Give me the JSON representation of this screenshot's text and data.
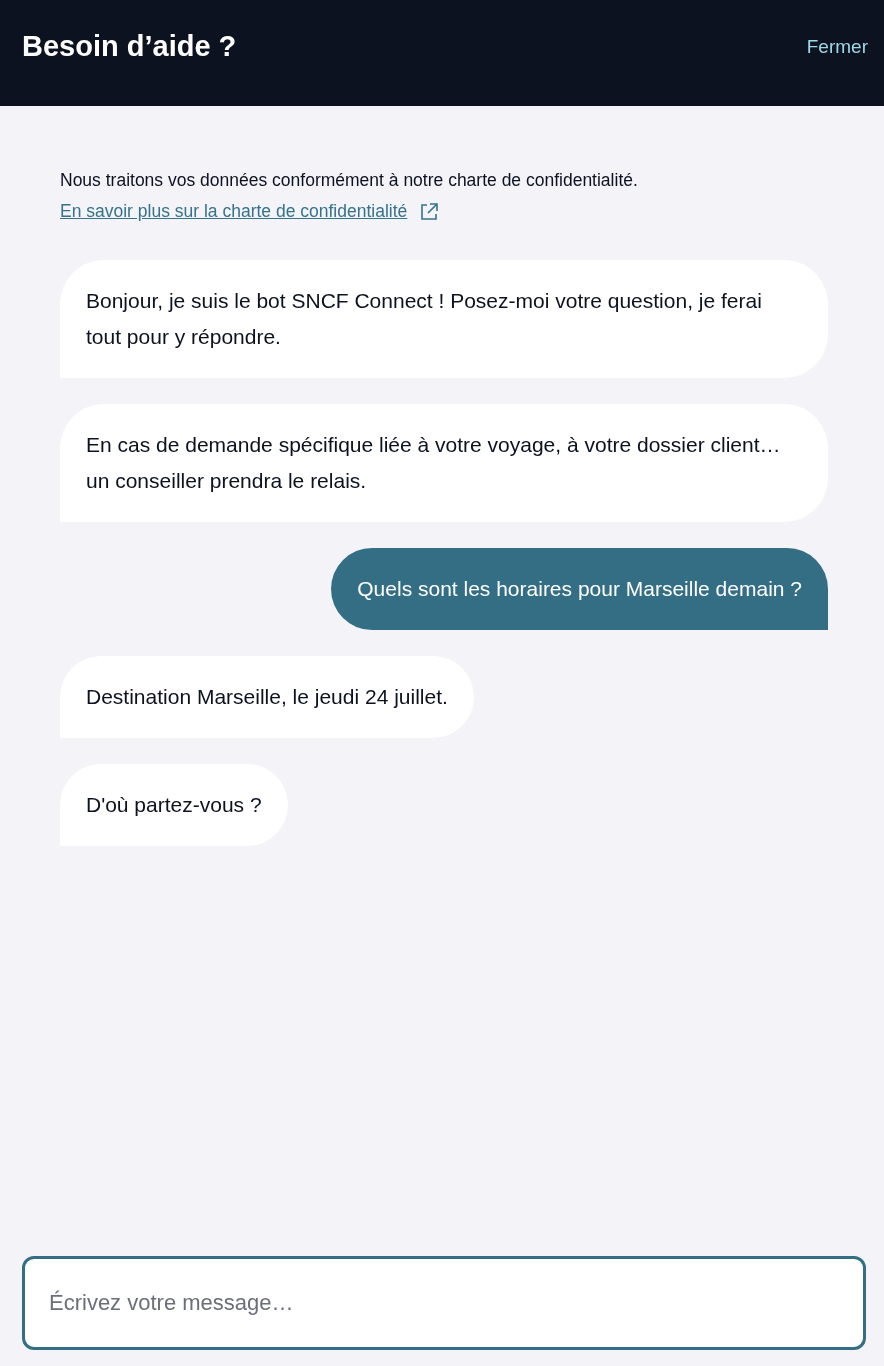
{
  "header": {
    "title": "Besoin d’aide ?",
    "close_link": "Fermer"
  },
  "privacy": {
    "notice": "Nous traitons vos données conformément à notre charte de confidentialité.",
    "link": "En savoir plus sur la charte de confidentialité"
  },
  "messages": [
    {
      "kind": "bot",
      "text": "Bonjour, je suis le bot SNCF Connect ! Posez-moi votre question, je ferai tout pour y répondre."
    },
    {
      "kind": "bot",
      "text": "En cas de demande spécifique liée à votre voyage, à votre dossier client… un conseiller prendra le relais."
    },
    {
      "kind": "user",
      "text": "Quels sont les horaires pour Marseille demain ?"
    },
    {
      "kind": "bot",
      "text": "Destination Marseille, le jeudi 24 juillet."
    },
    {
      "kind": "bot",
      "text": "D'où partez-vous ?"
    }
  ],
  "composer": {
    "placeholder": "Écrivez votre message…"
  }
}
